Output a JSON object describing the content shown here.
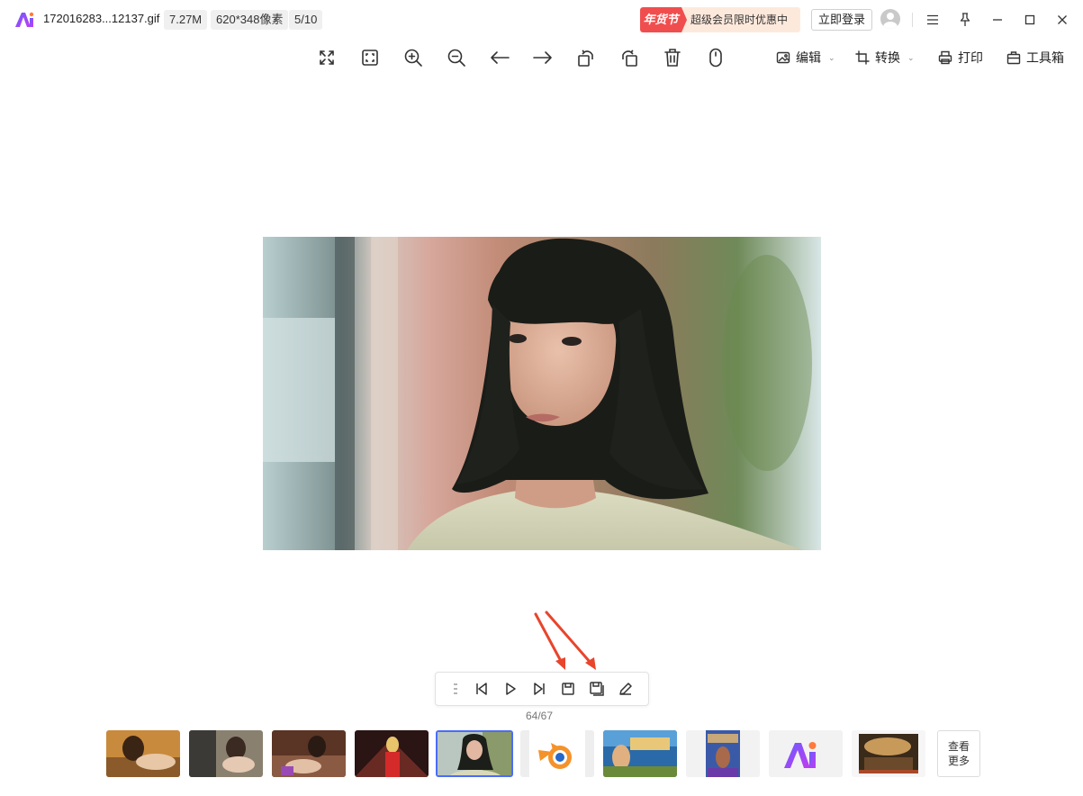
{
  "titlebar": {
    "filename": "172016283...12137.gif",
    "filesize": "7.27M",
    "dimensions": "620*348像素",
    "position": "5/10",
    "promo_tag": "年货节",
    "promo_text": "超级会员限时优惠中",
    "login_label": "立即登录"
  },
  "toolbar": {
    "icons": [
      "fullscreen-icon",
      "fit-window-icon",
      "zoom-in-icon",
      "zoom-out-icon",
      "arrow-left-icon",
      "arrow-right-icon",
      "rotate-left-icon",
      "rotate-right-icon",
      "trash-icon",
      "mouse-icon"
    ],
    "edit_label": "编辑",
    "convert_label": "转换",
    "print_label": "打印",
    "toolbox_label": "工具箱"
  },
  "playback": {
    "frame_counter": "64/67"
  },
  "thumbnails": {
    "count": 10,
    "active_index": 4,
    "more_label_line1": "查看",
    "more_label_line2": "更多"
  },
  "colors": {
    "accent": "#4b6cf7",
    "promo_red": "#f04e4e",
    "promo_bg": "#fde9dc",
    "annotation_arrow": "#e8452c"
  }
}
